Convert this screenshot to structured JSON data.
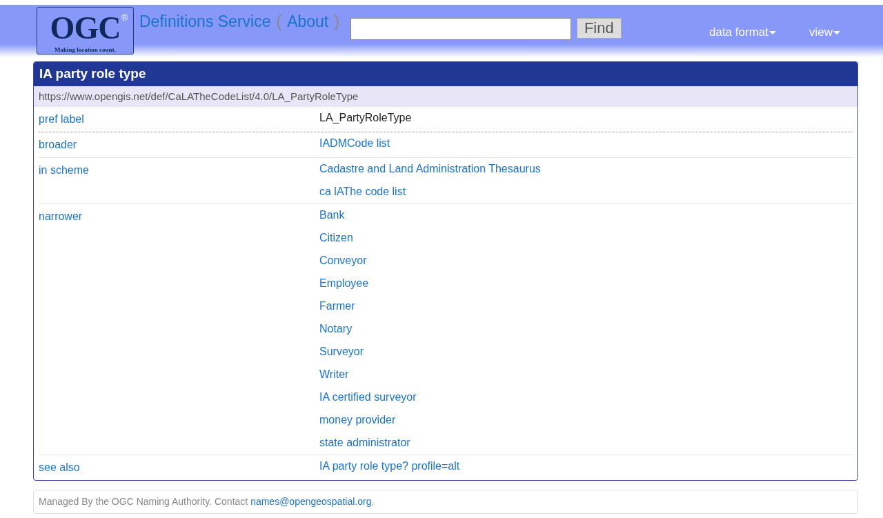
{
  "header": {
    "logo": {
      "text": "OGC",
      "mark": "®",
      "tagline": "Making location count."
    },
    "service_link": "Definitions Service",
    "open_paren": "(",
    "about_link": "About",
    "close_paren": ")",
    "search": {
      "button": "Find"
    },
    "menus": [
      {
        "label": "data format"
      },
      {
        "label": "view"
      }
    ]
  },
  "concept": {
    "title": "IA party role type",
    "uri": "https://www.opengis.net/def/CaLATheCodeList/4.0/LA_PartyRoleType",
    "properties": [
      {
        "label": "pref label",
        "kind": "text",
        "dotted": true,
        "values": [
          "LA_PartyRoleType"
        ]
      },
      {
        "label": "broader",
        "kind": "link",
        "dotted": false,
        "values": [
          "IADMCode list"
        ]
      },
      {
        "label": "in scheme",
        "kind": "link",
        "dotted": false,
        "values": [
          "Cadastre and Land Administration Thesaurus",
          "ca lAThe code list"
        ]
      },
      {
        "label": "narrower",
        "kind": "link",
        "dotted": false,
        "values": [
          "Bank",
          "Citizen",
          "Conveyor",
          "Employee",
          "Farmer",
          "Notary",
          "Surveyor",
          "Writer",
          "IA certified surveyor",
          "money provider",
          "state administrator"
        ]
      },
      {
        "label": "see also",
        "kind": "link",
        "dotted": false,
        "values": [
          "IA party role type? profile=alt"
        ]
      }
    ]
  },
  "footer": {
    "text": "Managed By the OGC Naming Authority. Contact ",
    "email": "names@opengeospatial.org",
    "end": "."
  }
}
